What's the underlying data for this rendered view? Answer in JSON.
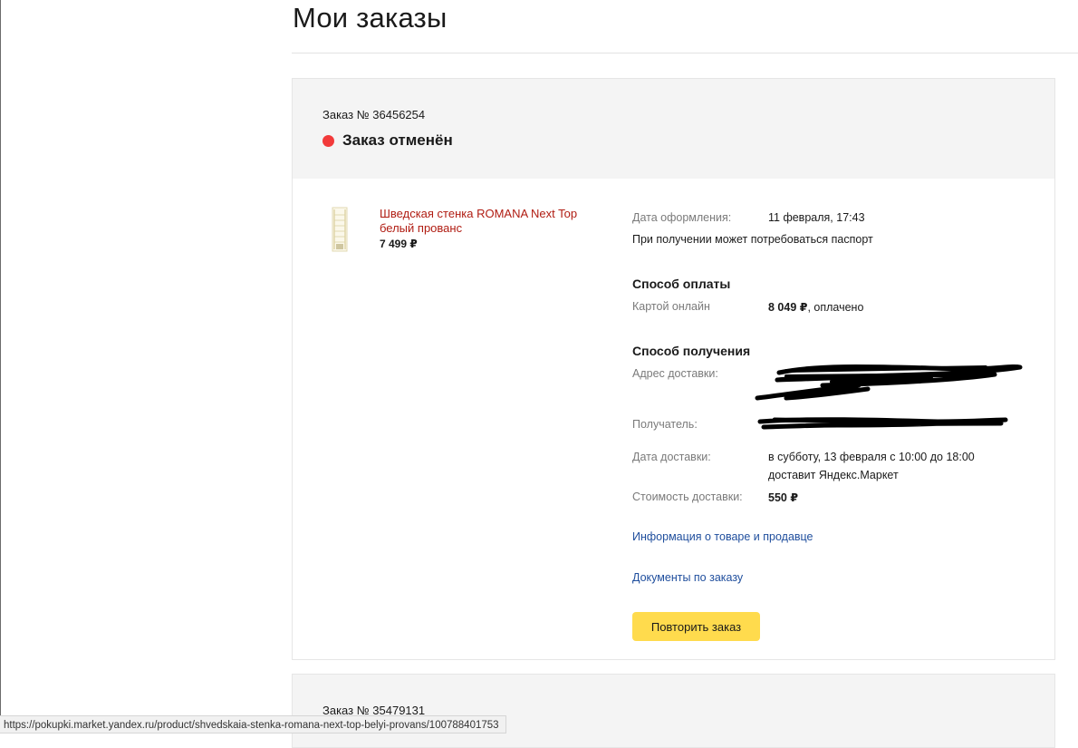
{
  "page": {
    "title": "Мои заказы"
  },
  "orders": [
    {
      "number_label": "Заказ № 36456254",
      "status": "Заказ отменён",
      "status_color": "#f23a3a",
      "product": {
        "name": "Шведская стенка ROMANA Next Top белый прованс",
        "price": "7 499 ₽"
      },
      "details": {
        "date_label": "Дата оформления:",
        "date_value": "11 февраля, 17:43",
        "passport_note": "При получении может потребоваться паспорт",
        "payment_title": "Способ оплаты",
        "payment_label": "Картой онлайн",
        "payment_amount": "8 049 ₽",
        "payment_status": ", оплачено",
        "delivery_title": "Способ получения",
        "address_label": "Адрес доставки:",
        "recipient_label": "Получатель:",
        "delivery_date_label": "Дата доставки:",
        "delivery_date_value": "в субботу, 13 февраля с 10:00 до 18:00",
        "delivery_by": "доставит Яндекс.Маркет",
        "delivery_cost_label": "Стоимость доставки:",
        "delivery_cost_value": "550 ₽"
      },
      "links": {
        "product_info": "Информация о товаре и продавце",
        "documents": "Документы по заказу"
      },
      "repeat_button": "Повторить заказ"
    },
    {
      "number_label": "Заказ № 35479131"
    }
  ],
  "status_bar": {
    "url": "https://pokupki.market.yandex.ru/product/shvedskaia-stenka-romana-next-top-belyi-provans/100788401753"
  },
  "colors": {
    "accent_button": "#ffdb4d",
    "link": "#1f4e9d",
    "product_link": "#b01c12",
    "header_bg": "#f4f4f4"
  }
}
